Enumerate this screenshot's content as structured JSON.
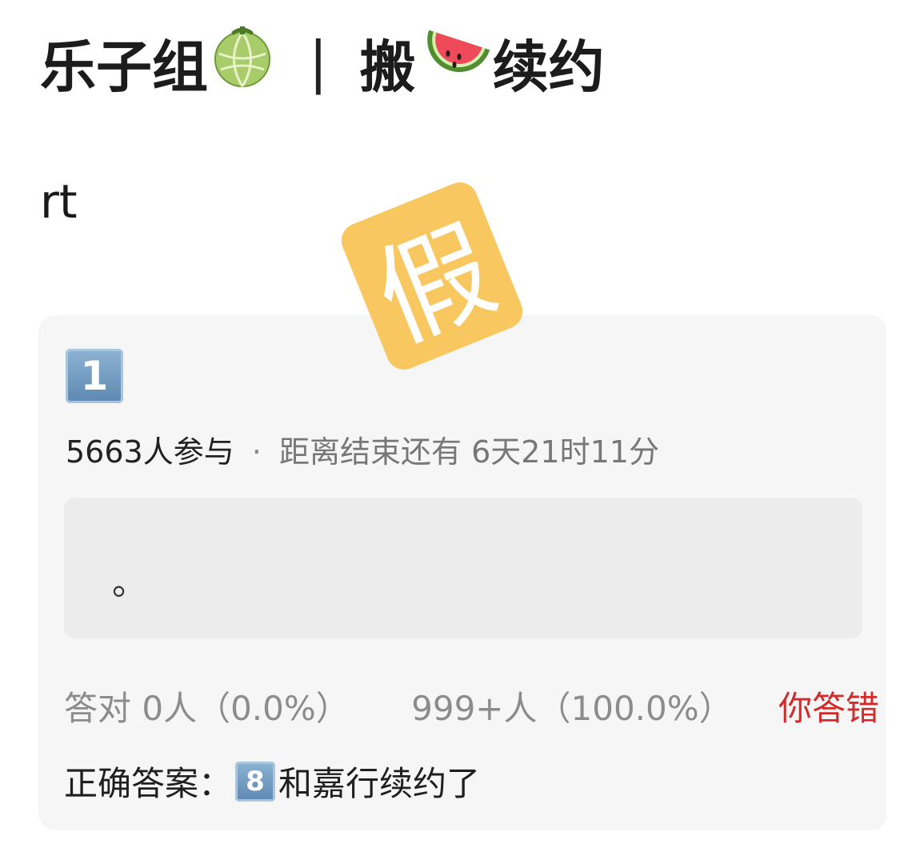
{
  "post": {
    "title_part1": "乐子组",
    "title_icon1": "melon-icon",
    "title_separator": "|",
    "title_part2": "搬",
    "title_icon2": "watermelon-icon",
    "title_part3": "续约",
    "body": "rt"
  },
  "watermark": {
    "text": "假",
    "color": "#f8c75f"
  },
  "quiz": {
    "number_badge": "1",
    "participants": "5663人参与",
    "separator": "·",
    "time_remaining": "距离结束还有 6天21时11分",
    "option_text": "。",
    "correct_stat": "答对 0人（0.0%）",
    "wrong_stat": "999+人（100.0%）",
    "your_result": "你答错",
    "answer_label": "正确答案：",
    "answer_badge": "8",
    "answer_text": "和嘉行续约了",
    "colors": {
      "card_bg": "#f6f6f6",
      "wrong_red": "#d42a2a",
      "muted": "#8c8c8c"
    }
  }
}
